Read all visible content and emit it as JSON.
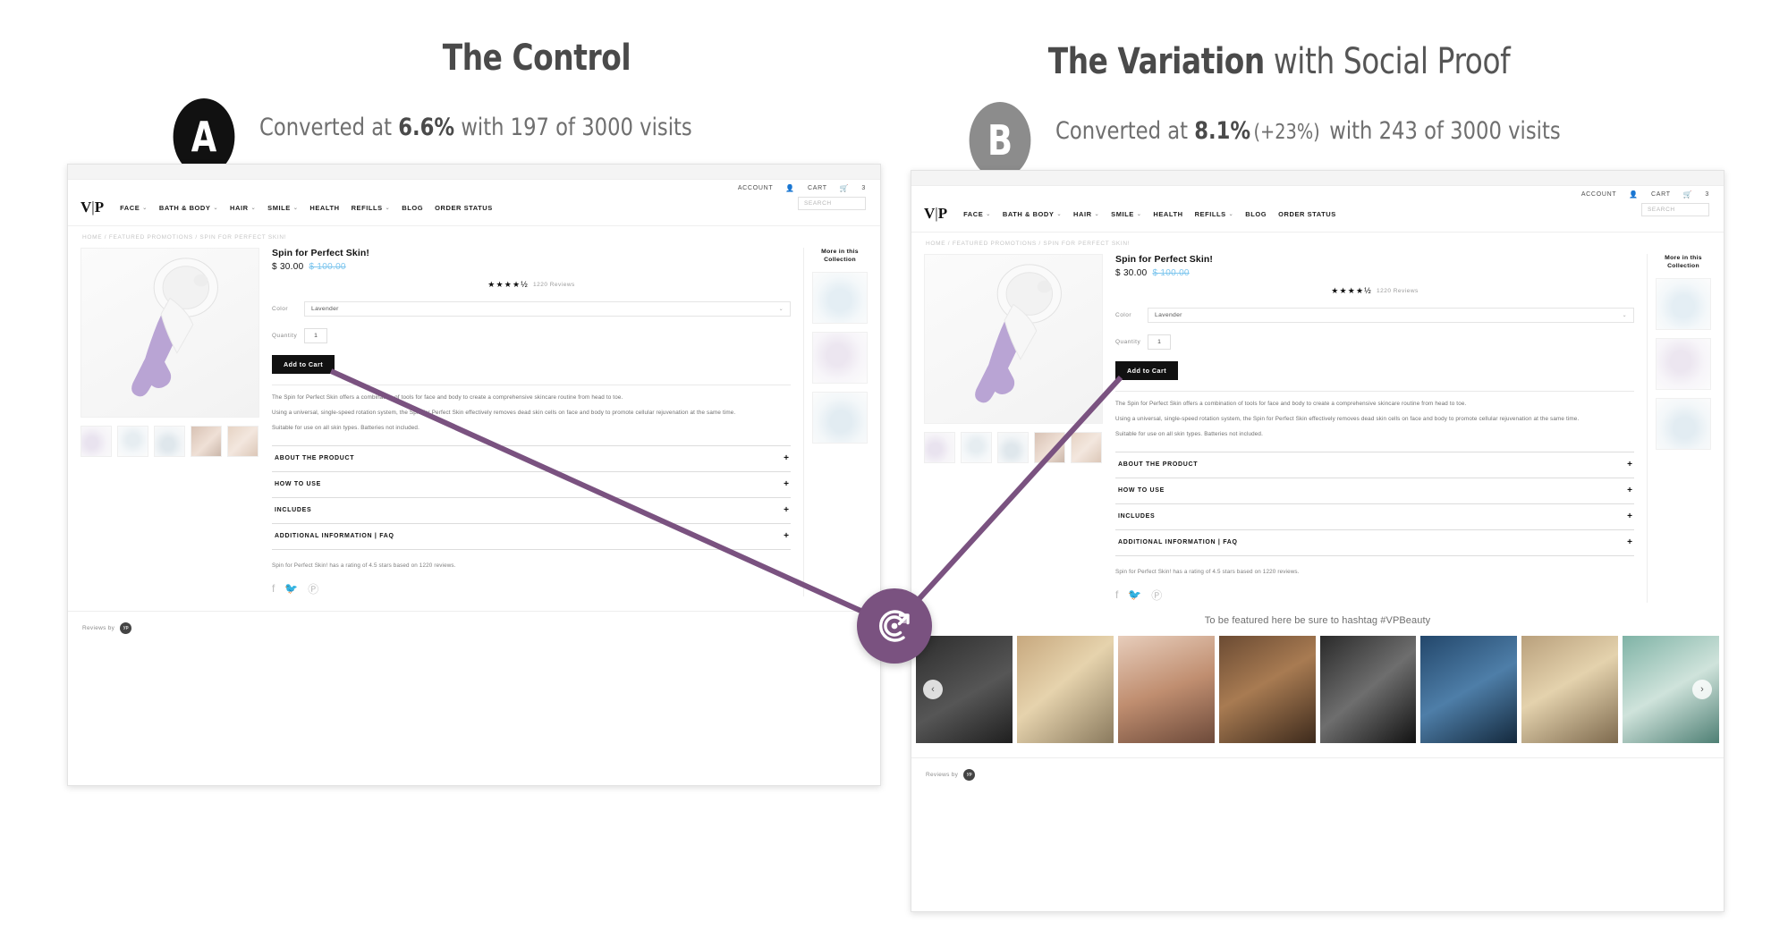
{
  "variants": [
    {
      "id": "A",
      "badge_letter": "A",
      "badge_color": "#111111",
      "title_bold": "The Control",
      "title_light": "",
      "subtitle_pre": "Converted at ",
      "conversion_rate": "6.6%",
      "lift": "",
      "subtitle_post": " with 197 of 3000 visits",
      "conversions": "197",
      "visits": "3000"
    },
    {
      "id": "B",
      "badge_letter": "B",
      "badge_color": "#8c8c8c",
      "title_bold": "The Variation",
      "title_light": " with Social Proof",
      "subtitle_pre": "Converted at ",
      "conversion_rate": "8.1%",
      "lift": "(+23%)",
      "subtitle_post": " with 243 of 3000 visits",
      "conversions": "243",
      "visits": "3000"
    }
  ],
  "site": {
    "logo_left": "V",
    "logo_bar": "|",
    "logo_right": "P",
    "utility": {
      "account_label": "ACCOUNT",
      "account_icon": "user-icon",
      "cart_label": "CART",
      "cart_icon": "cart-icon",
      "cart_count": "3"
    },
    "nav": [
      {
        "label": "FACE",
        "caret": "⌄"
      },
      {
        "label": "BATH & BODY",
        "caret": "⌄"
      },
      {
        "label": "HAIR",
        "caret": "⌄"
      },
      {
        "label": "SMILE",
        "caret": "⌄"
      },
      {
        "label": "HEALTH",
        "caret": ""
      },
      {
        "label": "REFILLS",
        "caret": "⌄"
      },
      {
        "label": "BLOG",
        "caret": ""
      },
      {
        "label": "ORDER STATUS",
        "caret": ""
      }
    ],
    "search_placeholder": "SEARCH",
    "breadcrumb": "HOME / FEATURED PROMOTIONS / SPIN FOR PERFECT SKIN!"
  },
  "product": {
    "title": "Spin for Perfect Skin!",
    "price": "$ 30.00",
    "compare_price": "$ 100.00",
    "stars_glyphs": "★★★★½",
    "reviews_label": "1220 Reviews",
    "color_label": "Color",
    "color_value": "Lavender",
    "color_chevron": "⌄",
    "quantity_label": "Quantity",
    "quantity_value": "1",
    "add_to_cart_label": "Add to Cart",
    "description": [
      "The Spin for Perfect Skin offers a combination of tools for face and body to create a comprehensive skincare routine from head to toe.",
      "Using a universal, single-speed rotation system, the Spin for Perfect Skin effectively removes dead skin cells on face and body to promote cellular rejuvenation at the same time.",
      "Suitable for use on all skin types. Batteries not included."
    ],
    "accordion": [
      {
        "label": "ABOUT THE PRODUCT",
        "toggle": "+"
      },
      {
        "label": "HOW TO USE",
        "toggle": "+"
      },
      {
        "label": "INCLUDES",
        "toggle": "+"
      },
      {
        "label": "ADDITIONAL INFORMATION | FAQ",
        "toggle": "+"
      }
    ],
    "rating_sentence": "Spin for Perfect Skin! has a rating of 4.5 stars based on 1220 reviews.",
    "social_icons": [
      {
        "name": "facebook-icon",
        "glyph": "f"
      },
      {
        "name": "twitter-icon",
        "glyph": "ᴠ"
      },
      {
        "name": "pinterest-icon",
        "glyph": "Ⓟ"
      }
    ],
    "more_collection_title": "More in this Collection",
    "reviews_by_label": "Reviews by",
    "reviews_by_badge": "yp"
  },
  "social_proof": {
    "headline": "To be featured here be sure to hashtag #VPBeauty",
    "prev_arrow": "‹",
    "next_arrow": "›",
    "tile_count": 8
  },
  "connector": {
    "hub_icon": "target-click-icon",
    "color": "#7a5280"
  }
}
